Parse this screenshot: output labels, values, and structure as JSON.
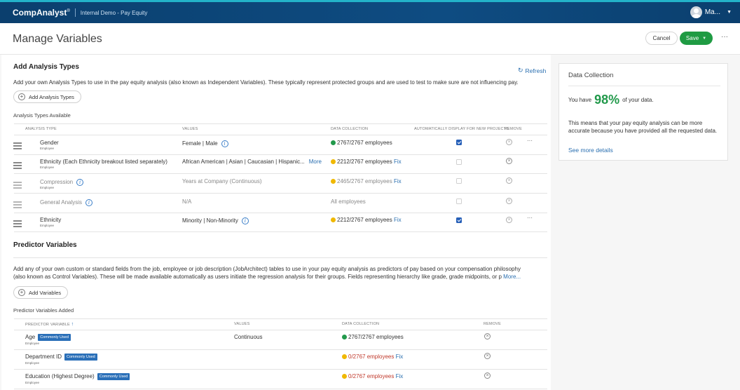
{
  "header": {
    "brand": "CompAnalyst",
    "brand_mark": "®",
    "context": "Internal Demo - Pay Equity",
    "user": "Ma..."
  },
  "toolbar": {
    "title": "Manage Variables",
    "cancel": "Cancel",
    "save": "Save",
    "more": "···"
  },
  "analysis": {
    "heading": "Add Analysis Types",
    "refresh": "Refresh",
    "description": "Add your own Analysis Types to use in the pay equity analysis (also known as Independent Variables). These typically represent protected groups and are used to test to make sure are not influencing pay.",
    "add_button": "Add Analysis Types",
    "available_label": "Analysis Types Available",
    "columns": {
      "type": "ANALYSIS TYPE",
      "values": "VALUES",
      "data": "DATA COLLECTION",
      "auto": "AUTOMATICALLY DISPLAY FOR NEW PROJECTS",
      "remove": "REMOVE"
    },
    "rows": [
      {
        "name": "Gender",
        "sub": "Employee",
        "values": "Female | Male",
        "data": "2767/2767 employees",
        "fix": ""
      },
      {
        "name": "Ethnicity (Each Ethnicity breakout listed separately)",
        "sub": "Employee",
        "values": "African American | Asian | Caucasian | Hispanic...",
        "more": "More",
        "data": "2212/2767 employees",
        "fix": "Fix"
      },
      {
        "name": "Compression",
        "sub": "Employee",
        "values": "Years at Company (Continuous)",
        "data": "2465/2767 employees",
        "fix": "Fix"
      },
      {
        "name": "General Analysis",
        "sub": "",
        "values": "N/A",
        "data": "All employees",
        "fix": ""
      },
      {
        "name": "Ethnicity",
        "sub": "Employee",
        "values": "Minority | Non-Minority",
        "data": "2212/2767 employees",
        "fix": "Fix"
      }
    ]
  },
  "predictors": {
    "heading": "Predictor Variables",
    "description_1": "Add any of your own custom or standard fields from the job, employee or job description (JobArchitect) tables to use in your pay equity analysis as predictors of pay based on your compensation philosophy",
    "description_2": "(also known as Control Variables). These will be made available automatically as users initiate the regression analysis for their groups. Fields representing hierarchy like grade, grade midpoints, or p",
    "description_more": "More...",
    "add_button": "Add Variables",
    "added_label": "Predictor Variables Added",
    "columns": {
      "variable": "PREDICTOR VARIABLE",
      "sort": "↑",
      "values": "VALUES",
      "data": "DATA COLLECTION",
      "remove": "REMOVE"
    },
    "rows": [
      {
        "name": "Age",
        "sub": "Employee",
        "badge": "Commonly Used",
        "values": "Continuous",
        "data": "2767/2767 employees",
        "fix": ""
      },
      {
        "name": "Department ID",
        "sub": "Employee",
        "badge": "Commonly Used",
        "values": "",
        "data": "0/2767 employees",
        "fix": "Fix"
      },
      {
        "name": "Education (Highest Degree)",
        "sub": "Employee",
        "badge": "Commonly Used",
        "values": "",
        "data": "0/2767 employees",
        "fix": "Fix"
      }
    ]
  },
  "side": {
    "title": "Data Collection",
    "prefix": "You have",
    "percent": "98%",
    "suffix": "of your data.",
    "description": "This means that your pay equity analysis can be more accurate because you have provided all the requested data.",
    "link": "See more details"
  }
}
